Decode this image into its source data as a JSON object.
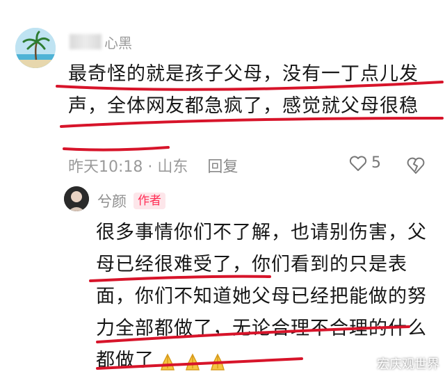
{
  "comment1": {
    "username": "心黑",
    "text": "最奇怪的就是孩子父母，没有一丁点儿发声，全体网友都急疯了，感觉就父母很稳",
    "time_location": "昨天10:18 · 山东",
    "reply_label": "回复",
    "like_count": "5",
    "icons": {
      "like": "heart-outline-icon",
      "dislike": "broken-heart-icon"
    }
  },
  "comment2": {
    "username": "兮颜",
    "badge": "作者",
    "text": "很多事情你们不了解，也请别伤害，父母已经很难受了，你们看到的只是表面，你们不知道她父母已经把能做的努力全部都做了，无论合理不合理的什么都做了",
    "emoji": "🙏🙏🙏"
  },
  "watermark": "宏庆观世界",
  "colors": {
    "underline": "#d7142a",
    "badge_text": "#ff2e55",
    "badge_bg": "#fde6ea",
    "meta": "#9a9a9a"
  }
}
